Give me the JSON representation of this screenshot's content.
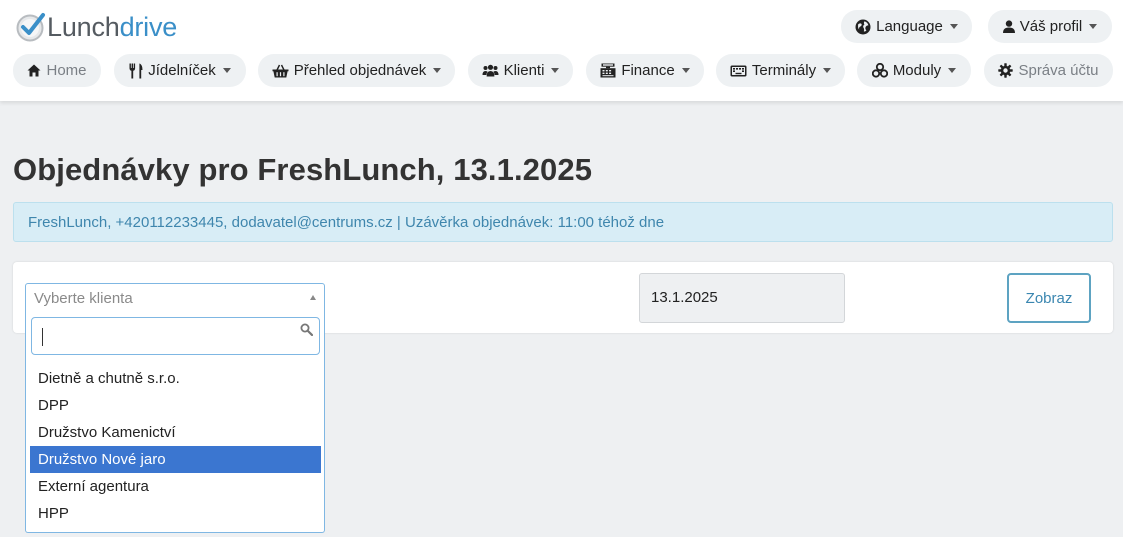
{
  "brand": {
    "part1": "Lunch",
    "part2": "drive"
  },
  "header": {
    "language_label": "Language",
    "profile_label": "Váš profil"
  },
  "nav": [
    {
      "label": "Home",
      "icon": "home-icon"
    },
    {
      "label": "Jídelníček",
      "icon": "cutlery-icon"
    },
    {
      "label": "Přehled objednávek",
      "icon": "basket-icon"
    },
    {
      "label": "Klienti",
      "icon": "users-icon"
    },
    {
      "label": "Finance",
      "icon": "cash-register-icon"
    },
    {
      "label": "Terminály",
      "icon": "keyboard-icon"
    },
    {
      "label": "Moduly",
      "icon": "modules-icon"
    },
    {
      "label": "Správa účtu",
      "icon": "gear-icon"
    }
  ],
  "page": {
    "title": "Objednávky pro FreshLunch, 13.1.2025",
    "info": "FreshLunch, +420112233445, dodavatel@centrums.cz | Uzávěrka objednávek: 11:00 téhož dne"
  },
  "filter": {
    "client_placeholder": "Vyberte klienta",
    "search_value": "",
    "options": [
      "Dietně a chutně s.r.o.",
      "DPP",
      "Družstvo Kamenictví",
      "Družstvo Nové jaro",
      "Externí agentura",
      "HPP"
    ],
    "highlighted_option": "Družstvo Nové jaro",
    "date_value": "13.1.2025",
    "submit_label": "Zobraz"
  },
  "colors": {
    "brand_dark": "#555b61",
    "brand_blue": "#3a8fc8",
    "highlight": "#3b76d0",
    "info_bg": "#d8edf6",
    "info_text": "#3f86ad"
  }
}
